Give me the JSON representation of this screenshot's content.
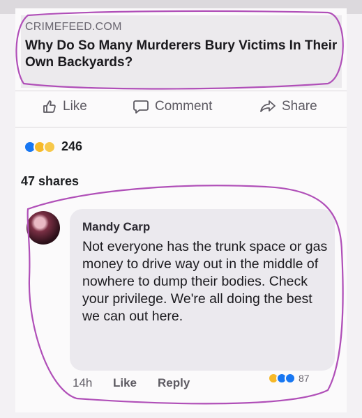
{
  "post": {
    "source": "CRIMEFEED.COM",
    "headline": "Why Do So Many Murderers Bury Victims In Their Own Backyards?"
  },
  "actions": {
    "like": "Like",
    "comment": "Comment",
    "share": "Share"
  },
  "stats": {
    "reaction_count": "246",
    "shares": "47 shares"
  },
  "comment": {
    "author": "Mandy Carp",
    "text": "Not everyone has the trunk space or gas money to drive way out in the middle of nowhere to dump their bodies. Check your privilege. We're all doing the best we can out here.",
    "time": "14h",
    "like": "Like",
    "reply": "Reply",
    "reaction_count": "87"
  },
  "colors": {
    "like_blue": "#1877f2",
    "love_red": "#f33e58",
    "haha_yellow": "#f7b928",
    "annotation": "#b04fb8"
  },
  "icons": {
    "like": "thumbs-up-icon",
    "comment": "speech-bubble-icon",
    "share": "share-arrow-icon"
  }
}
